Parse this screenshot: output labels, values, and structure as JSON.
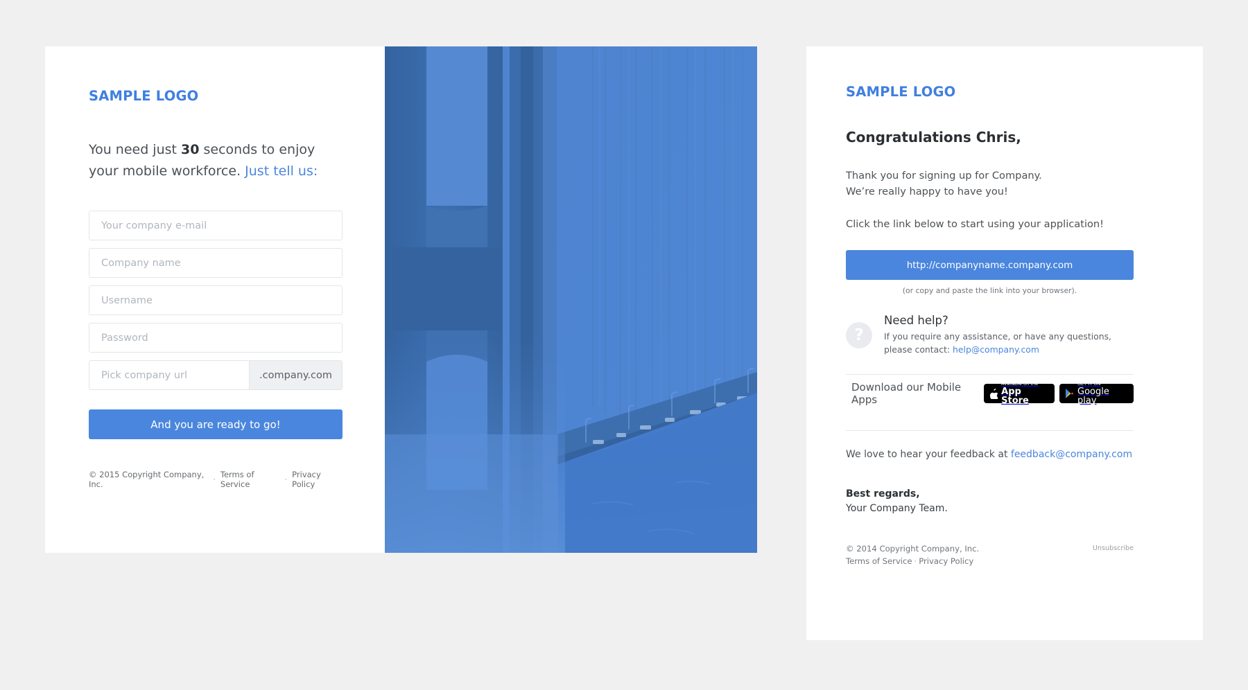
{
  "signup": {
    "logo": "SAMPLE LOGO",
    "intro": {
      "before": "You need just ",
      "number": "30",
      "middle": " seconds to enjoy your mobile workforce. ",
      "accent": "Just tell us:"
    },
    "fields": [
      {
        "name": "email",
        "placeholder": "Your company e-mail",
        "value": ""
      },
      {
        "name": "company",
        "placeholder": "Company name",
        "value": ""
      },
      {
        "name": "username",
        "placeholder": "Username",
        "value": ""
      },
      {
        "name": "password",
        "placeholder": "Password",
        "value": ""
      }
    ],
    "url_field": {
      "placeholder": "Pick company url",
      "value": "",
      "addon": ".company.com"
    },
    "submit_label": "And you are ready to go!",
    "footer": {
      "copyright": "© 2015 Copyright Company, Inc.",
      "separator": "·",
      "terms": "Terms of Service",
      "privacy": "Privacy Policy"
    }
  },
  "photo": {
    "alt": "golden-gate-bridge-photo",
    "overlay_color": "#4377c4",
    "tint_light": "#6b9ae0",
    "tint_dark": "#3a6ab3"
  },
  "email": {
    "logo": "SAMPLE LOGO",
    "greeting": "Congratulations Chris,",
    "paragraph1_line1": "Thank you for signing up for Company.",
    "paragraph1_line2": "We’re really happy to have you!",
    "paragraph2": "Click the link below to start using your application!",
    "cta_url": "http://companyname.company.com",
    "cta_note": "(or copy and paste the link into your browser).",
    "help": {
      "icon": "question-mark",
      "title": "Need help?",
      "body_before": "If you require any assistance, or have any questions, please contact: ",
      "email": "help@company.com"
    },
    "apps": {
      "label": "Download our Mobile Apps",
      "appstore": {
        "small": "Available on the",
        "big": "App Store"
      },
      "googleplay": {
        "small": "GET IT ON",
        "big": "Google",
        "big_light": " play"
      }
    },
    "feedback": {
      "before": "We love to hear your feedback at ",
      "email": "feedback@company.com"
    },
    "signoff_bold": "Best regards,",
    "signoff_team": "Your Company Team.",
    "footer": {
      "copyright": "© 2014 Copyright Company, Inc.",
      "terms": "Terms of Service",
      "separator": "·",
      "privacy": "Privacy Policy",
      "unsubscribe": "Unsubscribe"
    }
  },
  "colors": {
    "accent_blue": "#4a86dd",
    "logo_blue": "#3f7fe0",
    "page_bg": "#f0f0f0",
    "card_bg": "#ffffff"
  }
}
